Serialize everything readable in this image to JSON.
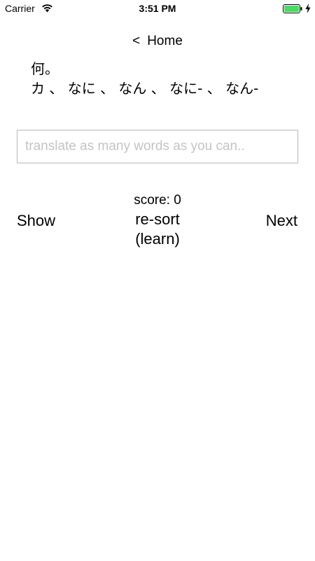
{
  "status_bar": {
    "carrier": "Carrier",
    "time": "3:51 PM",
    "battery_color": "#4cd964",
    "icons": [
      "wifi-icon",
      "battery-icon",
      "charging-bolt-icon"
    ]
  },
  "nav": {
    "back_chevron": "<",
    "back_label": "Home"
  },
  "card": {
    "kanji": "何。",
    "readings": "カ 、 なに 、 なん 、 なに- 、 なん-"
  },
  "answer_input": {
    "value": "",
    "placeholder": "translate as many words as you can.."
  },
  "score_text": "score: 0",
  "buttons": {
    "show": "Show",
    "resort_line1": "re-sort",
    "resort_line2": "(learn)",
    "next": "Next"
  }
}
